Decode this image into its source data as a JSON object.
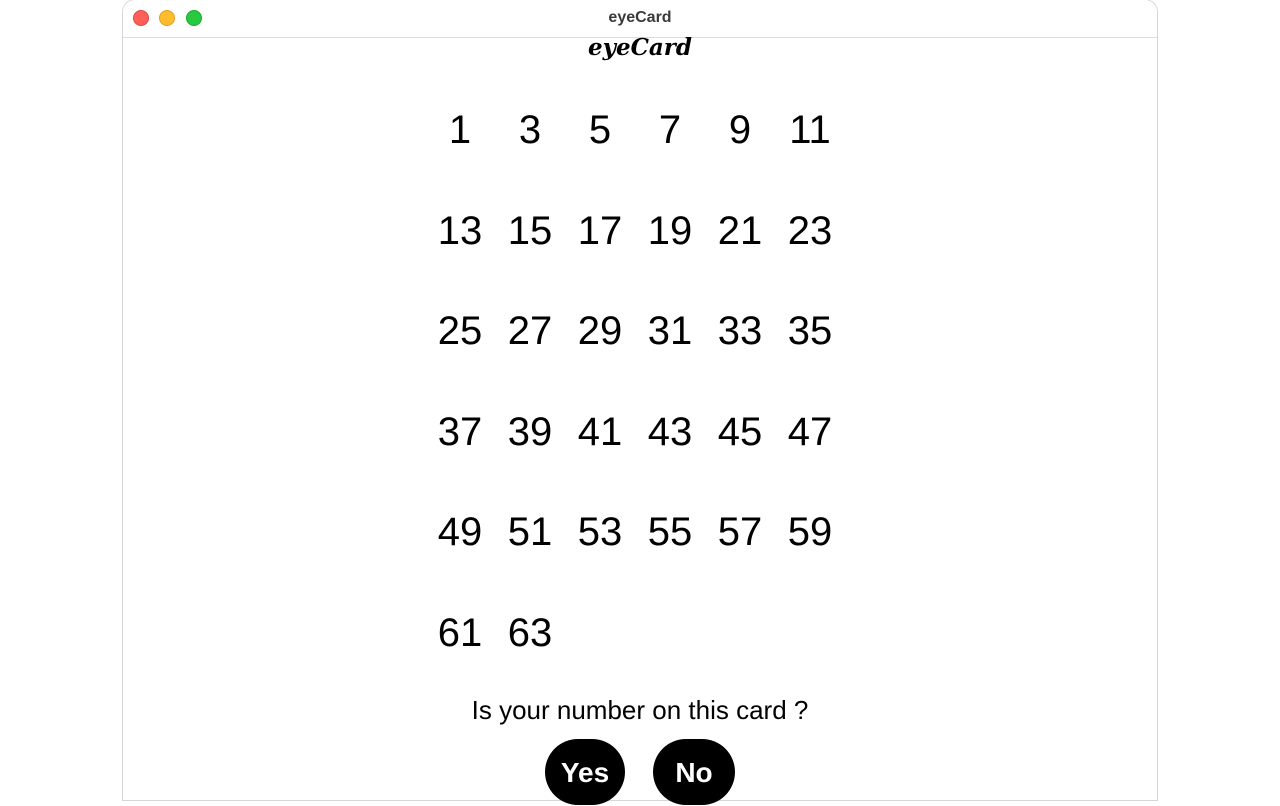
{
  "window": {
    "title": "eyeCard"
  },
  "app": {
    "title": "eyeCard"
  },
  "card": {
    "numbers": [
      "1",
      "3",
      "5",
      "7",
      "9",
      "11",
      "13",
      "15",
      "17",
      "19",
      "21",
      "23",
      "25",
      "27",
      "29",
      "31",
      "33",
      "35",
      "37",
      "39",
      "41",
      "43",
      "45",
      "47",
      "49",
      "51",
      "53",
      "55",
      "57",
      "59",
      "61",
      "63"
    ]
  },
  "prompt": {
    "question": "Is your number on this card ?",
    "yes_label": "Yes",
    "no_label": "No"
  },
  "colors": {
    "close": "#fe5f57",
    "minimize": "#febc2e",
    "maximize": "#28c840",
    "button_bg": "#000000",
    "button_text": "#ffffff"
  }
}
